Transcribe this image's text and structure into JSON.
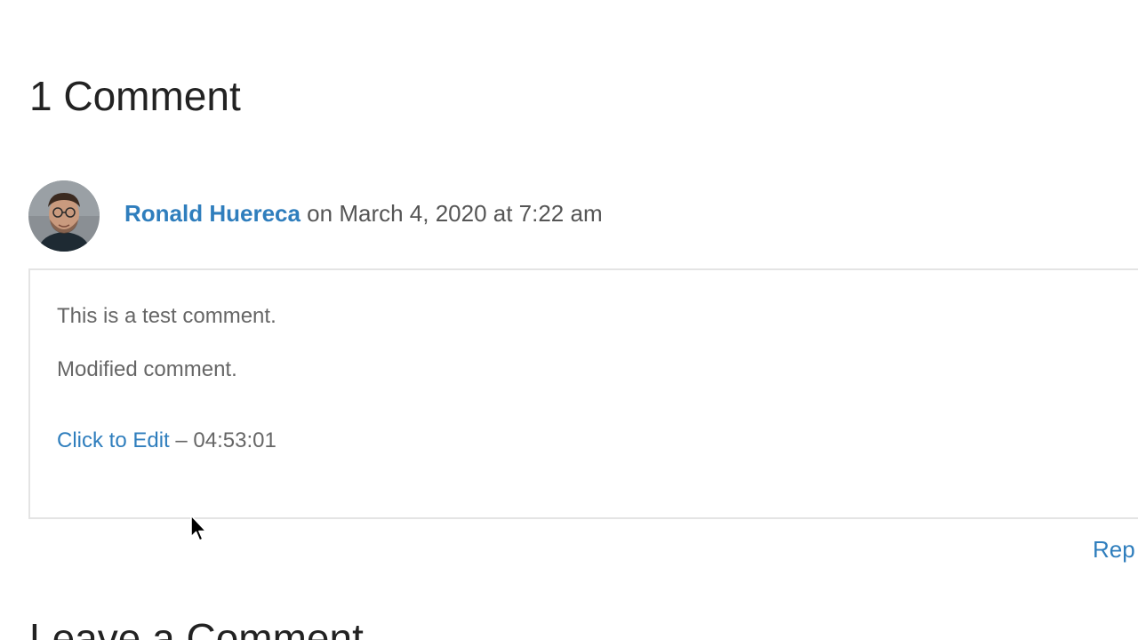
{
  "comments": {
    "title": "1 Comment",
    "items": [
      {
        "author": "Ronald Huereca",
        "date_text": " on March 4, 2020 at 7:22 am",
        "paragraphs": [
          "This is a test comment.",
          "Modified comment."
        ],
        "edit_link": "Click to Edit",
        "edit_suffix": " – 04:53:01",
        "reply_label": "Rep"
      }
    ]
  },
  "leave_comment": {
    "title": "Leave a Comment"
  },
  "colors": {
    "link": "#2f7ebd",
    "text": "#666666",
    "heading": "#222222",
    "border": "#e4e4e4"
  },
  "icons": {
    "cursor": "arrow-cursor-icon"
  }
}
